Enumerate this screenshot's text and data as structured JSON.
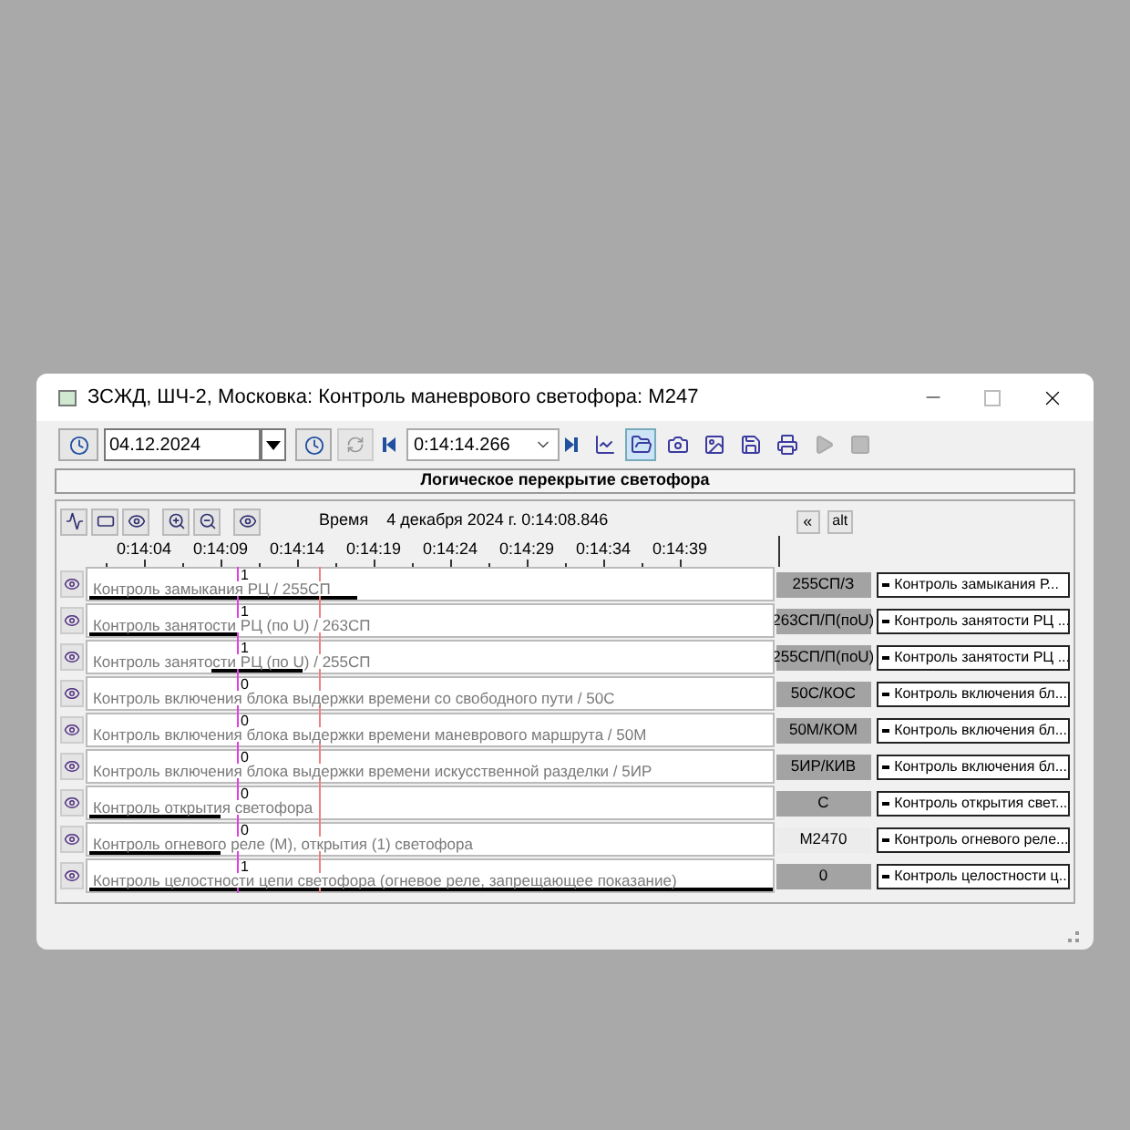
{
  "window": {
    "title": "ЗСЖД, ШЧ-2, Московка: Контроль маневрового светофора: М247"
  },
  "toolbar": {
    "date": "04.12.2024",
    "time": "0:14:14.266",
    "buttons": [
      {
        "kind": "chart",
        "selected": false,
        "disabled": false
      },
      {
        "kind": "open",
        "selected": true,
        "disabled": false
      },
      {
        "kind": "camera",
        "selected": false,
        "disabled": false
      },
      {
        "kind": "image",
        "selected": false,
        "disabled": false
      },
      {
        "kind": "save",
        "selected": false,
        "disabled": false
      },
      {
        "kind": "print",
        "selected": false,
        "disabled": false
      },
      {
        "kind": "play",
        "selected": false,
        "disabled": true
      },
      {
        "kind": "stop",
        "selected": false,
        "disabled": true
      }
    ]
  },
  "header": "Логическое перекрытие светофора",
  "chart": {
    "tools": [
      {
        "kind": "line"
      },
      {
        "kind": "frame"
      },
      {
        "kind": "eye"
      },
      {
        "kind": "zoom-in"
      },
      {
        "kind": "zoom-out"
      },
      {
        "kind": "eye"
      }
    ],
    "time_label": "Время",
    "time_value": "4 декабря 2024 г. 0:14:08.846",
    "collapse": "«",
    "alt": "alt",
    "ticks": [
      "0:14:04",
      "0:14:09",
      "0:14:14",
      "0:14:19",
      "0:14:24",
      "0:14:29",
      "0:14:34",
      "0:14:39"
    ],
    "rows": [
      {
        "label": "Контроль замыкания РЦ / 255СП",
        "value": "1",
        "code": "255СП/З",
        "code_active": true,
        "button": "Контроль замыкания Р..."
      },
      {
        "label": "Контроль занятости РЦ (по U) / 263СП",
        "value": "1",
        "code": "263СП/П(поU)",
        "code_active": true,
        "button": "Контроль занятости РЦ ..."
      },
      {
        "label": "Контроль занятости РЦ (по U) / 255СП",
        "value": "1",
        "code": "255СП/П(поU)",
        "code_active": true,
        "button": "Контроль занятости РЦ ..."
      },
      {
        "label": "Контроль включения блока выдержки времени со свободного пути / 50С",
        "value": "0",
        "code": "50С/КОС",
        "code_active": true,
        "button": "Контроль включения бл..."
      },
      {
        "label": "Контроль включения блока выдержки времени маневрового маршрута / 50М",
        "value": "0",
        "code": "50М/КОМ",
        "code_active": true,
        "button": "Контроль включения бл..."
      },
      {
        "label": "Контроль включения блока выдержки времени искусственной разделки / 5ИР",
        "value": "0",
        "code": "5ИР/КИВ",
        "code_active": true,
        "button": "Контроль включения бл..."
      },
      {
        "label": "Контроль открытия светофора",
        "value": "0",
        "code": "С",
        "code_active": true,
        "button": "Контроль открытия свет..."
      },
      {
        "label": "Контроль огневого реле (М), открытия (1) светофора",
        "value": "0",
        "code": "М2470",
        "code_active": false,
        "button": "Контроль огневого реле..."
      },
      {
        "label": "Контроль целостности цепи светофора (огневое реле, запрещающее показание)",
        "value": "1",
        "code": "0",
        "code_active": true,
        "button": "Контроль целостности ц..."
      }
    ]
  }
}
